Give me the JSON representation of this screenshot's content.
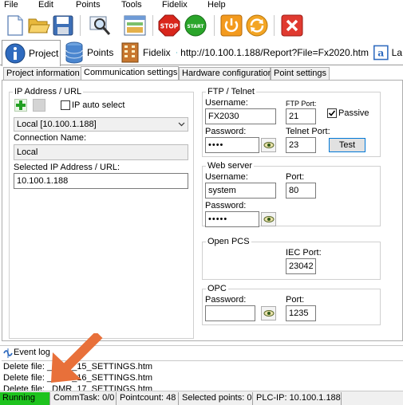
{
  "menu": [
    "File",
    "Edit",
    "Points",
    "Tools",
    "Fidelix",
    "Help"
  ],
  "toolbar": {
    "buttons": [
      "new-file-icon",
      "open-folder-icon",
      "save-disk-icon",
      "search-inspect-icon",
      "layout-window-icon",
      "stop-sign-icon",
      "start-sign-icon",
      "power-icon",
      "refresh-cycle-icon",
      "close-x-icon"
    ],
    "stop_text": "STOP",
    "start_text": "START"
  },
  "top_tabs": [
    {
      "label": "Project",
      "icon": "info-icon"
    },
    {
      "label": "Points",
      "icon": "database-icon"
    },
    {
      "label": "Fidelix",
      "icon": "building-icon"
    },
    {
      "label": "http://10.100.1.188/Report?File=Fx2020.htm",
      "icon": "edge-browser-icon"
    },
    {
      "label": "La",
      "icon": "text-a-icon"
    }
  ],
  "sub_tabs": [
    "Project information",
    "Communication settings",
    "Hardware configuration",
    "Point settings"
  ],
  "ip": {
    "group_title": "IP Address / URL",
    "auto_select_label": "IP auto select",
    "auto_select_checked": false,
    "combo_value": "Local [10.100.1.188]",
    "conn_name_label": "Connection Name:",
    "conn_name_value": "Local",
    "selected_label": "Selected IP Address / URL:",
    "selected_value": "10.100.1.188"
  },
  "ftp": {
    "group_title": "FTP / Telnet",
    "username_label": "Username:",
    "username_value": "FX2030",
    "ftp_port_label": "FTP Port:",
    "ftp_port_value": "21",
    "passive_label": "Passive",
    "passive_checked": true,
    "password_label": "Password:",
    "password_value": "••••",
    "telnet_port_label": "Telnet Port:",
    "telnet_port_value": "23",
    "test_label": "Test"
  },
  "web": {
    "group_title": "Web server",
    "username_label": "Username:",
    "username_value": "system",
    "port_label": "Port:",
    "port_value": "80",
    "password_label": "Password:",
    "password_value": "•••••"
  },
  "opcs": {
    "group_title": "Open PCS",
    "iec_port_label": "IEC Port:",
    "iec_port_value": "23042"
  },
  "opc": {
    "group_title": "OPC",
    "password_label": "Password:",
    "password_value": "",
    "port_label": "Port:",
    "port_value": "1235"
  },
  "event_log": {
    "title": "Event log",
    "lines": [
      "Delete file: _DMR_15_SETTINGS.htm",
      "Delete file: _DMR_16_SETTINGS.htm",
      "Delete file: _DMR_17_SETTINGS.htm"
    ]
  },
  "status": {
    "running": "Running",
    "commtask": "CommTask: 0/0",
    "pointcount": "Pointcount: 48",
    "selected": "Selected points: 0",
    "plcip": "PLC-IP: 10.100.1.188"
  },
  "colors": {
    "running_bg": "#1ec31e",
    "arrow": "#e8703a",
    "stop_red": "#d9261c",
    "start_green": "#2aa52a"
  }
}
